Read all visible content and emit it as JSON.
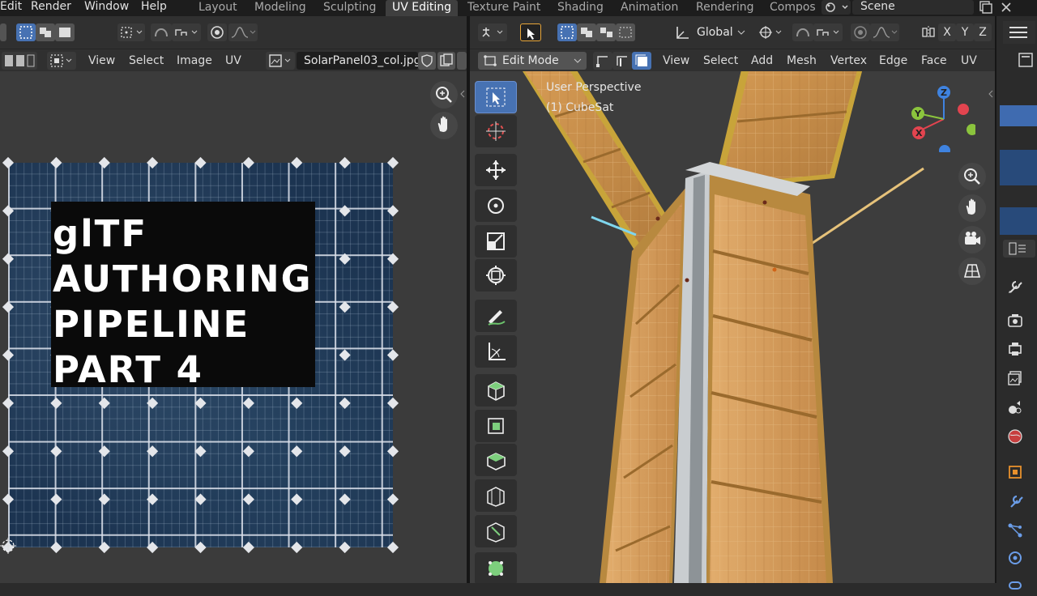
{
  "menu": {
    "edit": "Edit",
    "render": "Render",
    "window": "Window",
    "help": "Help"
  },
  "workspaces": {
    "layout": "Layout",
    "modeling": "Modeling",
    "sculpting": "Sculpting",
    "uv_editing": "UV Editing",
    "texture_paint": "Texture Paint",
    "shading": "Shading",
    "animation": "Animation",
    "rendering": "Rendering",
    "compositing": "Compos"
  },
  "scene": {
    "name": "Scene"
  },
  "uv_editor": {
    "menus": {
      "view": "View",
      "select": "Select",
      "image": "Image",
      "uv": "UV"
    },
    "image_name": "SolarPanel03_col.jpg"
  },
  "overlay_title": {
    "line1": "glTF",
    "line2": "AUTHORING",
    "line3": "PIPELINE",
    "line4": "PART 4"
  },
  "viewport": {
    "mode": "Edit Mode",
    "orientation": "Global",
    "menus": {
      "view": "View",
      "select": "Select",
      "add": "Add",
      "mesh": "Mesh",
      "vertex": "Vertex",
      "edge": "Edge",
      "face": "Face",
      "uv": "UV"
    },
    "axis_x": "X",
    "axis_y": "Y",
    "axis_z": "Z",
    "view_name": "User Perspective",
    "object_name": "(1) CubeSat",
    "gizmo": {
      "x": "X",
      "y": "Y",
      "z": "Z",
      "color_x": "#e2444f",
      "color_y": "#8bc43d",
      "color_z": "#3f83e0"
    }
  },
  "colors": {
    "accent": "#4772b3",
    "panel_gold": "#c38a45",
    "frame_silver": "#b9bec2"
  }
}
